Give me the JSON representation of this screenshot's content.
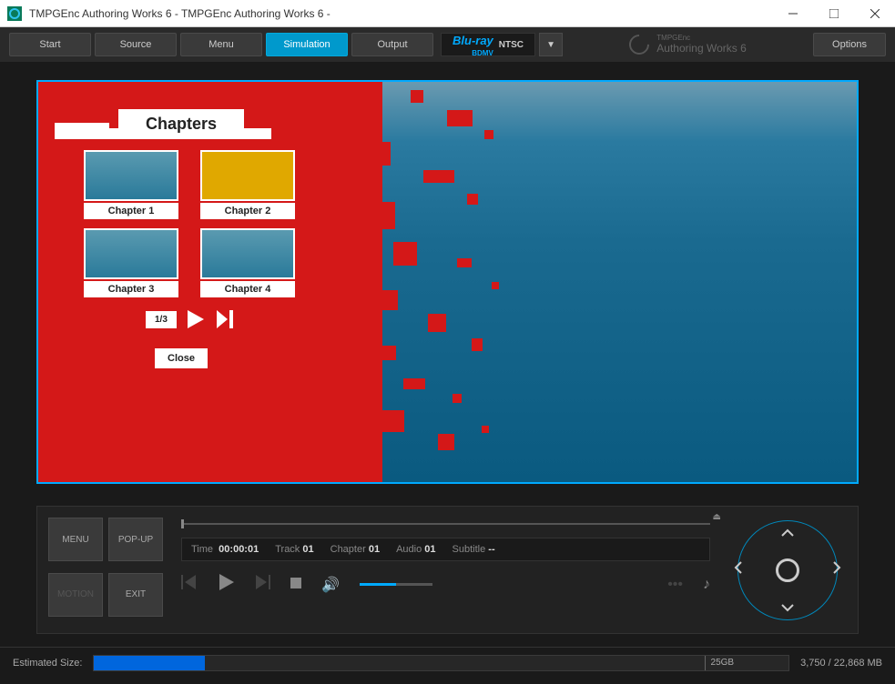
{
  "window": {
    "title": "TMPGEnc Authoring Works 6 - TMPGEnc Authoring Works 6 -"
  },
  "toolbar": {
    "start": "Start",
    "source": "Source",
    "menu": "Menu",
    "simulation": "Simulation",
    "output": "Output",
    "options": "Options"
  },
  "format": {
    "brand": "Blu-ray",
    "sub": "BDMV",
    "std": "NTSC"
  },
  "brand": {
    "line1": "TMPGEnc",
    "line2": "Authoring Works 6"
  },
  "menuPreview": {
    "title": "Chapters",
    "chapters": [
      "Chapter 1",
      "Chapter 2",
      "Chapter 3",
      "Chapter 4"
    ],
    "page": "1/3",
    "close": "Close"
  },
  "playback": {
    "menu": "MENU",
    "popup": "POP-UP",
    "motion": "MOTION",
    "exit": "EXIT",
    "timeLabel": "Time",
    "time": "00:00:01",
    "trackLabel": "Track",
    "track": "01",
    "chapterLabel": "Chapter",
    "chapter": "01",
    "audioLabel": "Audio",
    "audio": "01",
    "subtitleLabel": "Subtitle",
    "subtitle": "--"
  },
  "status": {
    "label": "Estimated Size:",
    "limit": "25GB",
    "text": "3,750 / 22,868 MB"
  }
}
